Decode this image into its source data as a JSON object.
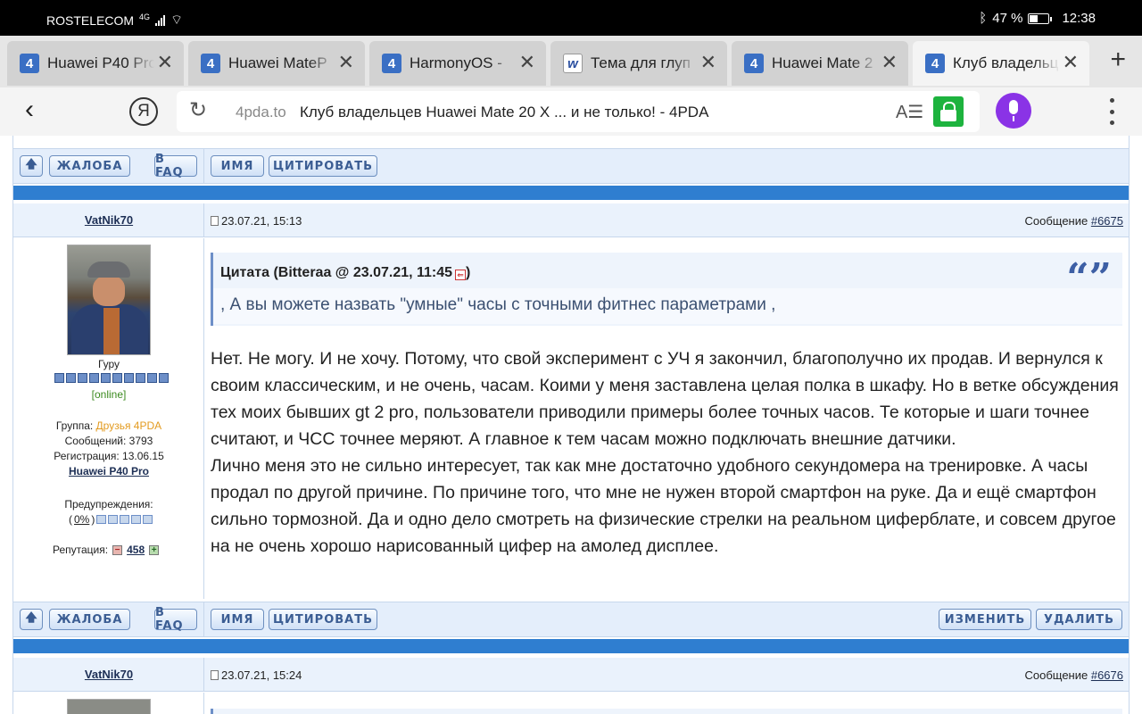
{
  "status_bar": {
    "carrier": "ROSTELECOM",
    "network": "4G",
    "battery": "47 %",
    "battery_level": 0.47,
    "time": "12:38"
  },
  "tabs": [
    {
      "title": "Huawei P40 Pro",
      "favicon": "4pda-icon"
    },
    {
      "title": "Huawei MateP",
      "favicon": "4pda-icon"
    },
    {
      "title": "HarmonyOS -",
      "favicon": "4pda-icon"
    },
    {
      "title": "Тема для глуп",
      "favicon": "w-icon"
    },
    {
      "title": "Huawei Mate 2",
      "favicon": "4pda-icon"
    },
    {
      "title": "Клуб владельц",
      "favicon": "4pda-icon",
      "active": true
    }
  ],
  "address_bar": {
    "domain": "4pda.to",
    "page_title": "Клуб владельцев Huawei Mate 20 X ... и не только! - 4PDA",
    "ya_label": "Я",
    "reader_label": "A☰"
  },
  "buttons": {
    "complaint": "ЖАЛОБА",
    "faq": "В FAQ",
    "name": "ИМЯ",
    "quote": "ЦИТИРОВАТЬ",
    "edit": "ИЗМЕНИТЬ",
    "delete": "УДАЛИТЬ",
    "up": "🡅"
  },
  "post1": {
    "author": "VatNik70",
    "date": "23.07.21, 15:13",
    "message_label": "Сообщение",
    "message_no": "#6675",
    "profile": {
      "rank": "Гуру",
      "status": "[online]",
      "group_label": "Группа:",
      "group": "Друзья 4PDA",
      "posts": "Сообщений: 3793",
      "registered": "Регистрация: 13.06.15",
      "device": "Huawei P40 Pro",
      "warnings_label": "Предупреждения:",
      "warnings_pct_open": "(",
      "warnings_pct": "0%",
      "warnings_pct_close": ")",
      "reputation_label": "Репутация:",
      "reputation": "458",
      "rep_minus": "−",
      "rep_plus": "+"
    },
    "quote": {
      "header": "Цитата (Bitteraa @ 23.07.21, 11:45",
      "header_close": ")",
      "text": ", А вы можете назвать \"умные\" часы с точными фитнес параметрами ,",
      "mark": "“”"
    },
    "paragraphs": [
      "Нет. Не могу. И не хочу. Потому, что свой эксперимент с УЧ я закончил, благополучно их продав. И вернулся к своим классическим, и не очень, часам. Коими у меня заставлена целая полка в шкафу. Но в ветке обсуждения тех моих бывших gt 2 pro, пользователи приводили примеры более точных часов. Те которые и шаги точнее считают, и ЧСС точнее меряют. А главное к тем часам можно подключать внешние датчики.",
      "Лично меня это не сильно интересует, так как мне достаточно удобного секундомера на тренировке. А часы продал по другой причине. По причине того, что мне не нужен второй смартфон на руке. Да и ещё смартфон сильно тормозной. Да и одно дело смотреть на физические стрелки на реальном циферблате, и совсем другое на не очень хорошо нарисованный цифер на амолед дисплее."
    ]
  },
  "post2": {
    "author": "VatNik70",
    "date": "23.07.21, 15:24",
    "message_label": "Сообщение",
    "message_no": "#6676"
  }
}
